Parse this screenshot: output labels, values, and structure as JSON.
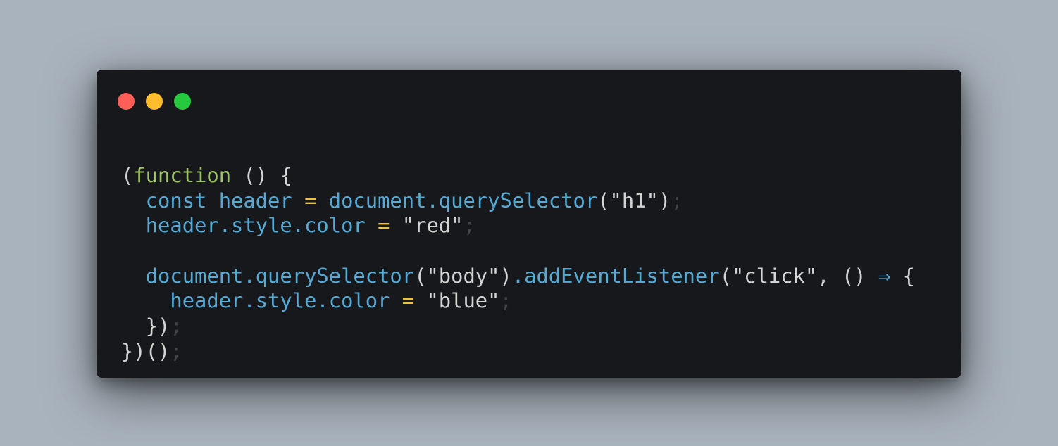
{
  "colors": {
    "background": "#a9b3bd",
    "window": "#17181b",
    "close": "#ff5f56",
    "minimize": "#ffbd2e",
    "maximize": "#27c93f",
    "keyword_function": "#9fc36a",
    "identifier": "#55abd6",
    "punctuation": "#d4d4d4",
    "operator": "#eec33a",
    "string": "#d4d4d4",
    "semicolon": "#3f4448",
    "arrow": "#55abd6"
  },
  "window_controls": [
    {
      "name": "close",
      "icon": "close-dot"
    },
    {
      "name": "minimize",
      "icon": "minimize-dot"
    },
    {
      "name": "maximize",
      "icon": "maximize-dot"
    }
  ],
  "code_lines": [
    [
      {
        "t": "(",
        "c": "punctuation"
      },
      {
        "t": "function",
        "c": "keyword_function"
      },
      {
        "t": " () {",
        "c": "punctuation"
      }
    ],
    [
      {
        "t": "  ",
        "c": "punctuation"
      },
      {
        "t": "const header",
        "c": "identifier"
      },
      {
        "t": " = ",
        "c": "operator"
      },
      {
        "t": "document.querySelector",
        "c": "identifier"
      },
      {
        "t": "(",
        "c": "punctuation"
      },
      {
        "t": "\"h1\"",
        "c": "string"
      },
      {
        "t": ")",
        "c": "punctuation"
      },
      {
        "t": ";",
        "c": "semicolon"
      }
    ],
    [
      {
        "t": "  ",
        "c": "punctuation"
      },
      {
        "t": "header.style.color",
        "c": "identifier"
      },
      {
        "t": " = ",
        "c": "operator"
      },
      {
        "t": "\"red\"",
        "c": "string"
      },
      {
        "t": ";",
        "c": "semicolon"
      }
    ],
    [],
    [
      {
        "t": "  ",
        "c": "punctuation"
      },
      {
        "t": "document.querySelector",
        "c": "identifier"
      },
      {
        "t": "(",
        "c": "punctuation"
      },
      {
        "t": "\"body\"",
        "c": "string"
      },
      {
        "t": ")",
        "c": "punctuation"
      },
      {
        "t": ".addEventListener",
        "c": "identifier"
      },
      {
        "t": "(",
        "c": "punctuation"
      },
      {
        "t": "\"click\"",
        "c": "string"
      },
      {
        "t": ", () ",
        "c": "punctuation"
      },
      {
        "t": "⇒",
        "c": "arrow"
      },
      {
        "t": " {",
        "c": "punctuation"
      }
    ],
    [
      {
        "t": "    ",
        "c": "punctuation"
      },
      {
        "t": "header.style.color",
        "c": "identifier"
      },
      {
        "t": " = ",
        "c": "operator"
      },
      {
        "t": "\"blue\"",
        "c": "string"
      },
      {
        "t": ";",
        "c": "semicolon"
      }
    ],
    [
      {
        "t": "  })",
        "c": "punctuation"
      },
      {
        "t": ";",
        "c": "semicolon"
      }
    ],
    [
      {
        "t": "})()",
        "c": "punctuation"
      },
      {
        "t": ";",
        "c": "semicolon"
      }
    ]
  ]
}
